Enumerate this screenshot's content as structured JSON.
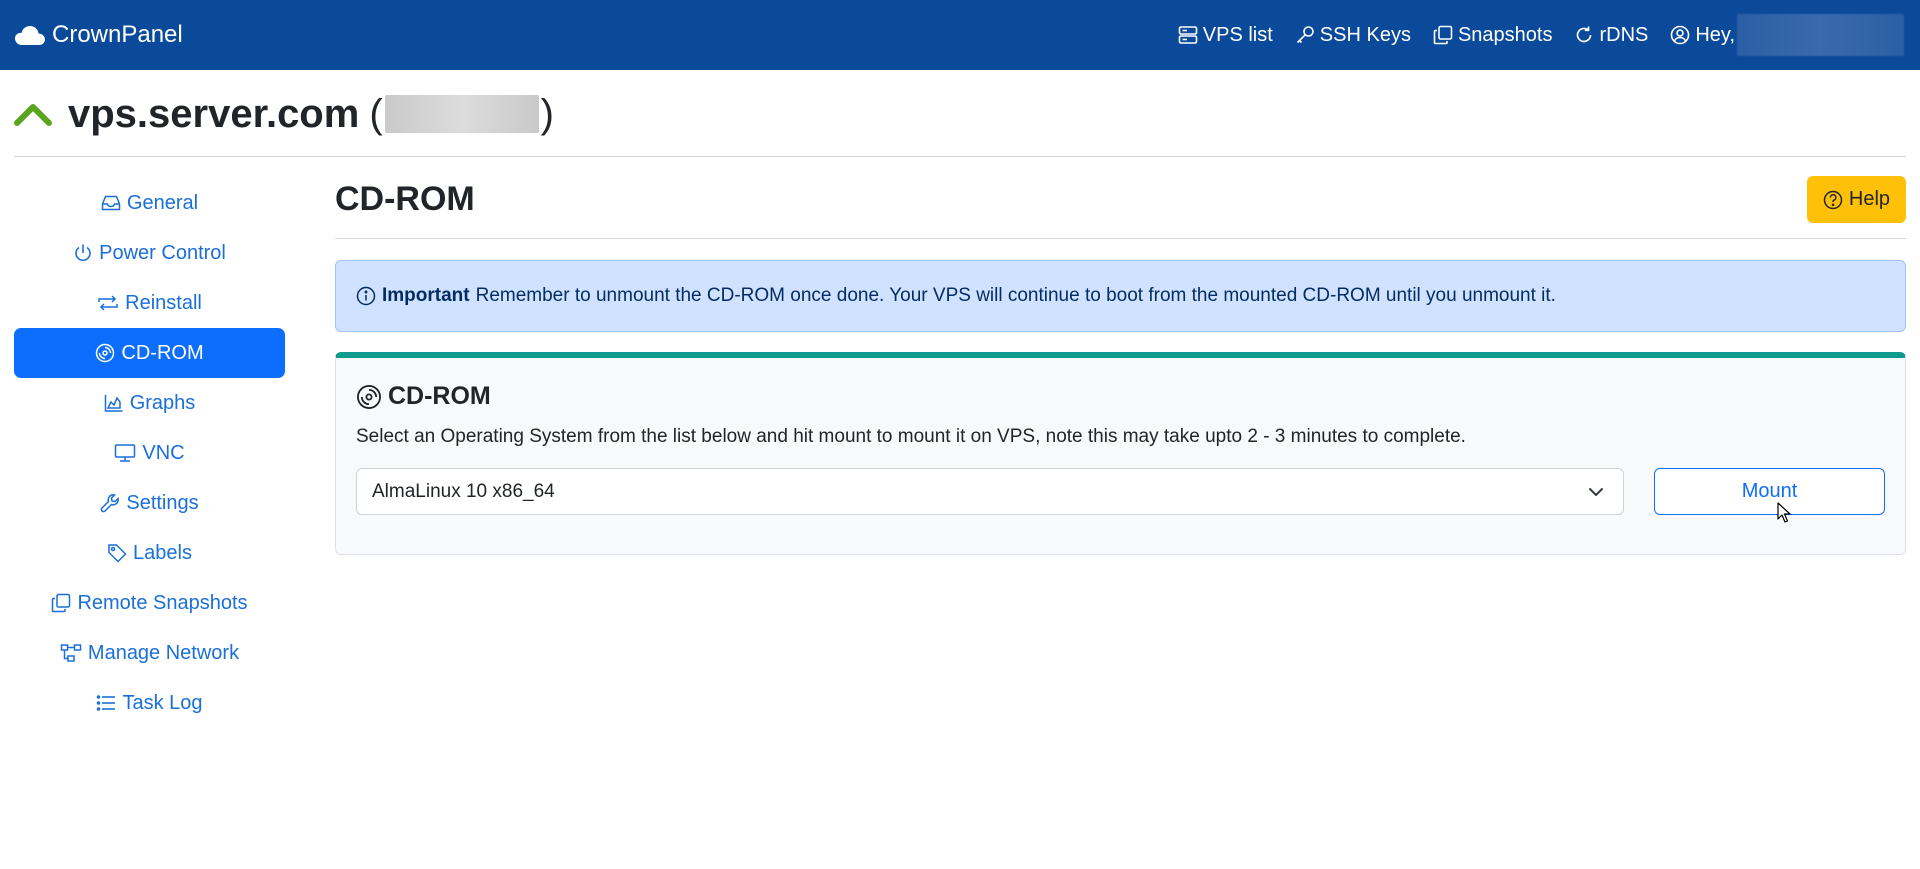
{
  "navbar": {
    "brand": "CrownPanel",
    "links": [
      {
        "label": "VPS list",
        "icon": "server-icon"
      },
      {
        "label": "SSH Keys",
        "icon": "key-icon"
      },
      {
        "label": "Snapshots",
        "icon": "copy-icon"
      },
      {
        "label": "rDNS",
        "icon": "refresh-icon"
      }
    ],
    "user_greeting": "Hey,"
  },
  "header": {
    "status_icon": "chevron-up-icon",
    "status_color": "#5aa51e",
    "hostname": "vps.server.com",
    "open_paren": "(",
    "close_paren": ")"
  },
  "sidebar": {
    "items": [
      {
        "label": "General",
        "icon": "inbox-icon",
        "active": false
      },
      {
        "label": "Power Control",
        "icon": "power-icon",
        "active": false
      },
      {
        "label": "Reinstall",
        "icon": "arrows-repeat-icon",
        "active": false
      },
      {
        "label": "CD-ROM",
        "icon": "disc-icon",
        "active": true
      },
      {
        "label": "Graphs",
        "icon": "graph-icon",
        "active": false
      },
      {
        "label": "VNC",
        "icon": "monitor-icon",
        "active": false
      },
      {
        "label": "Settings",
        "icon": "wrench-icon",
        "active": false
      },
      {
        "label": "Labels",
        "icon": "tag-icon",
        "active": false
      },
      {
        "label": "Remote Snapshots",
        "icon": "copy-icon",
        "active": false
      },
      {
        "label": "Manage Network",
        "icon": "network-icon",
        "active": false
      },
      {
        "label": "Task Log",
        "icon": "list-icon",
        "active": false
      }
    ]
  },
  "main": {
    "title": "CD-ROM",
    "help_label": "Help",
    "alert": {
      "strong": "Important",
      "text": "Remember to unmount the CD-ROM once done. Your VPS will continue to boot from the mounted CD-ROM until you unmount it."
    },
    "card": {
      "title": "CD-ROM",
      "description": "Select an Operating System from the list below and hit mount to mount it on VPS, note this may take upto 2 - 3 minutes to complete.",
      "selected_os": "AlmaLinux 10 x86_64",
      "mount_label": "Mount"
    }
  },
  "colors": {
    "navbar": "#0b4a9b",
    "accent": "#0d6efd",
    "help": "#ffc107",
    "card_border": "#0f9a8e",
    "alert_bg": "#cfe2ff"
  }
}
